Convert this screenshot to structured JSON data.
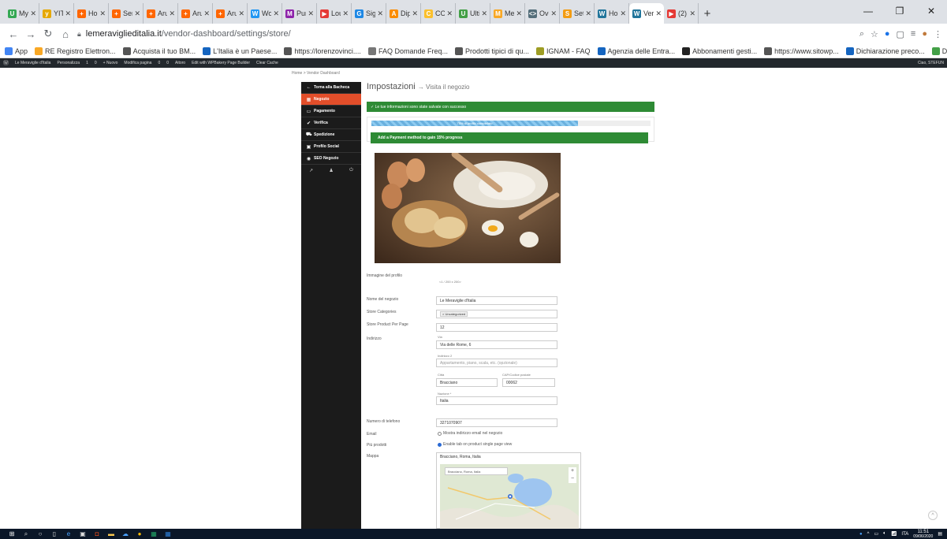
{
  "browser": {
    "tabs": [
      {
        "title": "My",
        "color": "#34a853",
        "glyph": "U"
      },
      {
        "title": "YITI",
        "color": "#e6a800",
        "glyph": "y"
      },
      {
        "title": "Hor",
        "color": "#ff6600",
        "glyph": "+"
      },
      {
        "title": "Ser",
        "color": "#ff6600",
        "glyph": "+"
      },
      {
        "title": "Aru",
        "color": "#ff6600",
        "glyph": "+"
      },
      {
        "title": "Aru",
        "color": "#ff6600",
        "glyph": "+"
      },
      {
        "title": "Aru",
        "color": "#ff6600",
        "glyph": "+"
      },
      {
        "title": "Wo",
        "color": "#2196f3",
        "glyph": "W"
      },
      {
        "title": "Pur",
        "color": "#8e24aa",
        "glyph": "M"
      },
      {
        "title": "Lou",
        "color": "#e53935",
        "glyph": "▶"
      },
      {
        "title": "Sig",
        "color": "#1e88e5",
        "glyph": "G"
      },
      {
        "title": "Dip",
        "color": "#fb8c00",
        "glyph": "A"
      },
      {
        "title": "CO",
        "color": "#fbc02d",
        "glyph": "C"
      },
      {
        "title": "Ulti",
        "color": "#43a047",
        "glyph": "U"
      },
      {
        "title": "Me",
        "color": "#f9a825",
        "glyph": "M"
      },
      {
        "title": "Ove",
        "color": "#546e7a",
        "glyph": "<>"
      },
      {
        "title": "Set",
        "color": "#f39c12",
        "glyph": "S"
      },
      {
        "title": "Hor",
        "color": "#21759b",
        "glyph": "W"
      },
      {
        "title": "Ver",
        "color": "#21759b",
        "glyph": "W",
        "active": true
      },
      {
        "title": "(2)",
        "color": "#e53935",
        "glyph": "▶"
      }
    ],
    "url_domain": "lemeraviglieditalia.it",
    "url_path": "/vendor-dashboard/settings/store/",
    "bookmarks": [
      {
        "label": "App",
        "color": "#4285f4"
      },
      {
        "label": "RE Registro Elettron...",
        "color": "#f9a825"
      },
      {
        "label": "Acquista il tuo BM...",
        "color": "#555555"
      },
      {
        "label": "L'Italia è un Paese...",
        "color": "#1565c0"
      },
      {
        "label": "https://lorenzovinci....",
        "color": "#555555"
      },
      {
        "label": "FAQ Domande Freq...",
        "color": "#777777"
      },
      {
        "label": "Prodotti tipici di qu...",
        "color": "#555555"
      },
      {
        "label": "IGNAM - FAQ",
        "color": "#9e9d24"
      },
      {
        "label": "Agenzia delle Entra...",
        "color": "#1565c0"
      },
      {
        "label": "Abbonamenti gesti...",
        "color": "#222222"
      },
      {
        "label": "https://www.sitowp...",
        "color": "#555555"
      },
      {
        "label": "Dichiarazione preco...",
        "color": "#1565c0"
      },
      {
        "label": "Dokan Zone Wise S...",
        "color": "#43a047"
      }
    ]
  },
  "adminbar": {
    "items": [
      "Le Meraviglie d'Italia",
      "Personalizza",
      "1",
      "0",
      "+ Nuovo",
      "Modifica pagina",
      "0",
      "0",
      "Aitoro",
      "Edit with WPBakery Page Builder",
      "Clear Cache"
    ],
    "right": "Ciao, STEFUN"
  },
  "page": {
    "breadcrumb": "Home > Vendor Dashboard",
    "sidebar": [
      {
        "label": "Torna alla Bacheca",
        "icon": "←",
        "name": "back-to-dashboard"
      },
      {
        "label": "Negozio",
        "icon": "▦",
        "name": "store",
        "active": true
      },
      {
        "label": "Pagamento",
        "icon": "▭",
        "name": "payment"
      },
      {
        "label": "Verifica",
        "icon": "✔",
        "name": "verification"
      },
      {
        "label": "Spedizione",
        "icon": "⛟",
        "name": "shipping"
      },
      {
        "label": "Profilo Social",
        "icon": "▣",
        "name": "social-profile"
      },
      {
        "label": "SEO Negozio",
        "icon": "◉",
        "name": "store-seo"
      }
    ],
    "sidebar_footer": [
      "↗",
      "♟",
      "⏻"
    ],
    "title": "Impostazioni",
    "title_link": "→ Visita il negozio",
    "success": "✓ Le tue informazioni sono state salvate con successo",
    "progress_label": "75% di profilo completato",
    "progress_value": 0.75,
    "progress_cta": "Add a Payment method to gain 15% progress",
    "profile_image_label": "Immagine del profilo",
    "profile_image_hint": "<1 / 200 x 200>",
    "fields": {
      "store_name_label": "Nome del negozio",
      "store_name": "Le Meraviglie d'Italia",
      "categories_label": "Store Categories",
      "categories_value": "× Uncategorized",
      "per_page_label": "Store Product Per Page",
      "per_page": "12",
      "address_label": "Indirizzo",
      "street_label": "Via",
      "street": "Via delle Rome, 6",
      "street2_label": "Indirizzo 2",
      "street2_placeholder": "Appartamento, piano, scala, etc. (opzionale)",
      "city_label": "Città",
      "city": "Bracciano",
      "zip_label": "CAP/Codice postale",
      "zip": "00062",
      "country_label": "Nazione *",
      "country": "Italia",
      "phone_label": "Numero di telefono",
      "phone": "3271070907",
      "email_label": "Email",
      "email_option": "Mostra indirizzo email nel negozio",
      "products_label": "Più prodotti",
      "products_option": "Enable tab on product single page view",
      "map_label": "Mappa",
      "map_value": "Bracciano, Roma, Italia",
      "map_search": "Bracciano, Roma, Italia"
    }
  },
  "taskbar": {
    "lang": "ITA",
    "time": "11:51",
    "date": "09/06/2020"
  }
}
